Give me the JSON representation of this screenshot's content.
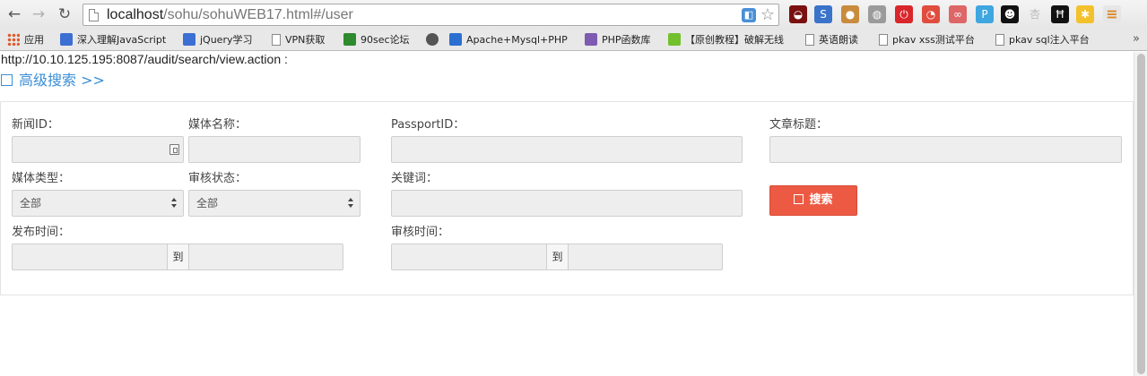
{
  "browser": {
    "url_host": "localhost",
    "url_path": "/sohu/sohuWEB17.html#/user",
    "extensions": [
      {
        "name": "mask-extension-icon",
        "color": "#7a1010",
        "glyph": "◒"
      },
      {
        "name": "translate-extension-icon",
        "color": "#3a73c9",
        "glyph": "S"
      },
      {
        "name": "cookie-extension-icon",
        "color": "#c98b3d",
        "glyph": "●"
      },
      {
        "name": "globe-extension-icon",
        "color": "#9b9b9b",
        "glyph": "◍"
      },
      {
        "name": "adblock-extension-icon",
        "color": "#d8262b",
        "glyph": "⏻"
      },
      {
        "name": "red-extension-icon",
        "color": "#e04d3f",
        "glyph": "◔"
      },
      {
        "name": "link-extension-icon",
        "color": "#d66",
        "glyph": "∞"
      },
      {
        "name": "p-extension-icon",
        "color": "#3ea6e0",
        "glyph": "P"
      },
      {
        "name": "anonymous-extension-icon",
        "color": "#111111",
        "glyph": "☻"
      },
      {
        "name": "hanzi-extension-icon",
        "color": "#cccccc",
        "glyph": "杏"
      },
      {
        "name": "h-extension-icon",
        "color": "#111111",
        "glyph": "Ħ"
      },
      {
        "name": "yellow-extension-icon",
        "color": "#f3c12c",
        "glyph": "✱"
      },
      {
        "name": "menu-icon",
        "color": "#e6e6e6",
        "glyph": "≡"
      }
    ]
  },
  "bookmarks": [
    {
      "label": "应用",
      "color": "#e0592a"
    },
    {
      "label": "深入理解JavaScript",
      "color": "#3b6fd3"
    },
    {
      "label": "jQuery学习",
      "color": "#3b6fd3"
    },
    {
      "label": "VPN获取",
      "color": "#ffffff"
    },
    {
      "label": "90sec论坛",
      "color": "#2d8a2d"
    },
    {
      "label": "",
      "color": "#555555"
    },
    {
      "label": "Apache+Mysql+PHP",
      "color": "#2b6fd1"
    },
    {
      "label": "PHP函数库",
      "color": "#7d5bb0"
    },
    {
      "label": "【原创教程】破解无线",
      "color": "#72c02c"
    },
    {
      "label": "英语朗读",
      "color": "#ffffff"
    },
    {
      "label": "pkav xss测试平台",
      "color": "#ffffff"
    },
    {
      "label": "pkav sql注入平台",
      "color": "#ffffff"
    }
  ],
  "page": {
    "action_url": "http://10.10.125.195:8087/audit/search/view.action :",
    "advanced_search": "高级搜索 >>",
    "form": {
      "news_id_label": "新闻ID：",
      "media_name_label": "媒体名称：",
      "passport_label": "PassportID：",
      "title_label": "文章标题：",
      "media_type_label": "媒体类型：",
      "media_type_value": "全部",
      "audit_status_label": "审核状态：",
      "audit_status_value": "全部",
      "keyword_label": "关键词：",
      "publish_time_label": "发布时间：",
      "audit_time_label": "审核时间：",
      "range_to": "到",
      "search_button": "搜索"
    }
  }
}
